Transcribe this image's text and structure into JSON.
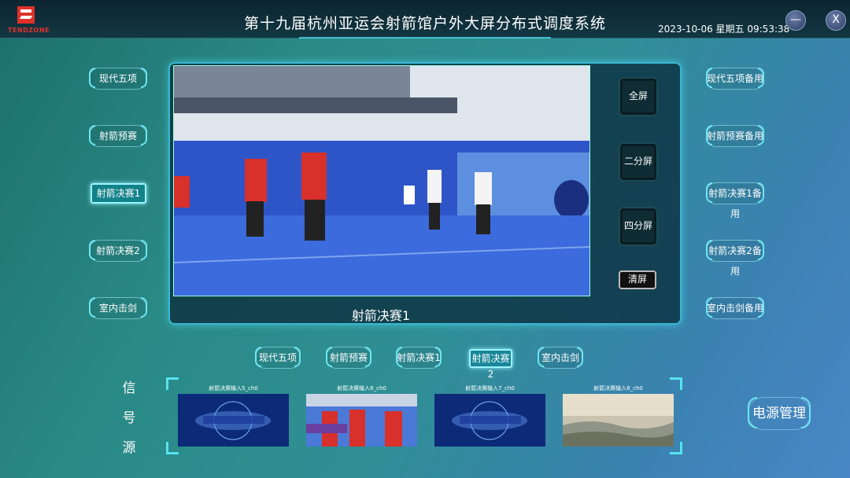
{
  "header": {
    "logo_text": "TENDZONE",
    "title": "第十九届杭州亚运会射箭馆户外大屏分布式调度系统",
    "datetime": "2023-10-06 星期五 09:53:38",
    "minimize_label": "—",
    "close_label": "X"
  },
  "left_menu": [
    "现代五项",
    "射箭预赛",
    "射箭决赛1",
    "射箭决赛2",
    "室内击剑"
  ],
  "left_active": "射箭决赛1",
  "right_menu": [
    "现代五项备用",
    "射箭预赛备用",
    "射箭决赛1备用",
    "射箭决赛2备用",
    "室内击剑备用"
  ],
  "layout_buttons": {
    "full": "全屏",
    "half": "二分屏",
    "quad": "四分屏",
    "clear": "清屏"
  },
  "main_display": {
    "label": "射箭决赛1"
  },
  "scene_tabs": [
    "现代五项",
    "射箭预赛",
    "射箭决赛1",
    "射箭决赛2",
    "室内击剑"
  ],
  "scene_active": "射箭决赛2",
  "signal_source": {
    "label_chars": [
      "信",
      "号",
      "源"
    ],
    "thumbs": [
      {
        "caption": "射箭决赛输入5_ch0"
      },
      {
        "caption": "射箭决赛输入6_ch0"
      },
      {
        "caption": "射箭决赛输入7_ch0"
      },
      {
        "caption": "射箭决赛输入8_ch0"
      }
    ]
  },
  "power_label": "电源管理",
  "colors": {
    "accent": "#57e3f0",
    "header_bg": "#0c2530",
    "logo_red": "#e0312b"
  }
}
